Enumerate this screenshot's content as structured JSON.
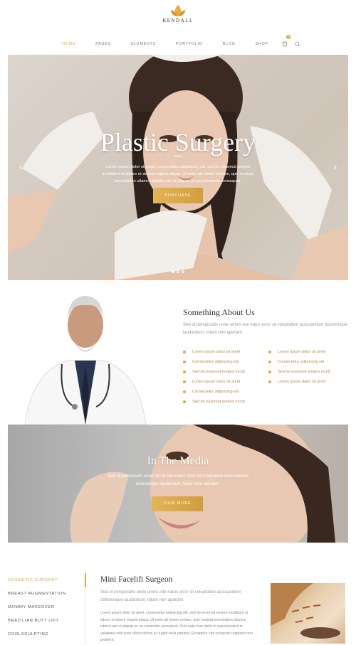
{
  "brand": {
    "name": "KENDALL",
    "logo_icon": "leaf-icon",
    "accent": "#e0a83a"
  },
  "nav": {
    "items": [
      "HOME",
      "PAGES",
      "ELEMENTS",
      "PORTFOLIO",
      "BLOG",
      "SHOP"
    ],
    "active": "HOME",
    "cart_count": "0"
  },
  "hero": {
    "title": "Plastic Surgery",
    "text": "Lorem ipsum dolor sit amet, consectetur adipiscing elit, sed do eiusmod tempor incididunt ut labore et dolore magna aliqua. Ut enim ad minim veniam, quis nostrud exercitation ullamco laboris nisi ut aliquip ex ea commodo consequat.",
    "button": "PURCHASE",
    "slides": 3,
    "active_slide": 1
  },
  "about": {
    "title": "Something About Us",
    "text": "Sed ut perspiciatis unde omnis iste natus error sit voluptatem accusantium doloremque laudantium, totam rem aperiam.",
    "features_left": [
      "Lorem ipsum dolor sit amet",
      "Consectetur adipiscing elit",
      "Sed do eiusmod tempor incidi",
      "Lorem ipsum dolor sit amet",
      "Consectetur adipiscing elit",
      "Sed do eiusmod tempor incidi"
    ],
    "features_right": [
      "Lorem ipsum dolor sit amet",
      "Consectetur adipiscing elit",
      "Sed do eiusmod tempor incidi",
      "Lorem ipsum dolor sit amet"
    ]
  },
  "media": {
    "title": "In The Media",
    "text": "Sed ut perspiciatis unde omnis iste natus error sit voluptatem accusantium doloremque laudantium, totam rem aperiam.",
    "button": "VIEW MORE"
  },
  "services": {
    "tabs": [
      "COSMETIC SURGERY",
      "BREAST AUGMENTATION",
      "MOMMY MAKEOVER",
      "BRAZILIAN BUTT LIFT",
      "COOLSCULPTING"
    ],
    "active_tab": "COSMETIC SURGERY",
    "title": "Mini Facelift Surgeon",
    "subtitle": "Sed ut perspiciatis unde omnis iste natus error sit voluptatem accusantium doloremque laudantium, totam rem aperiam.",
    "body": "Lorem ipsum dolor sit amet, consectetur adipiscing elit, sed do eiusmod tempor incididunt ut labore et dolore magna aliqua. Ut enim ad minim veniam, quis nostrud exercitation ullamco laboris nisi ut aliquip ex ea commodo consequat. Duis aute irure dolor in reprehenderit in voluptate velit esse cillum dolore eu fugiat nulla pariatur. Excepteur sint occaecat cupidatat non proident."
  }
}
